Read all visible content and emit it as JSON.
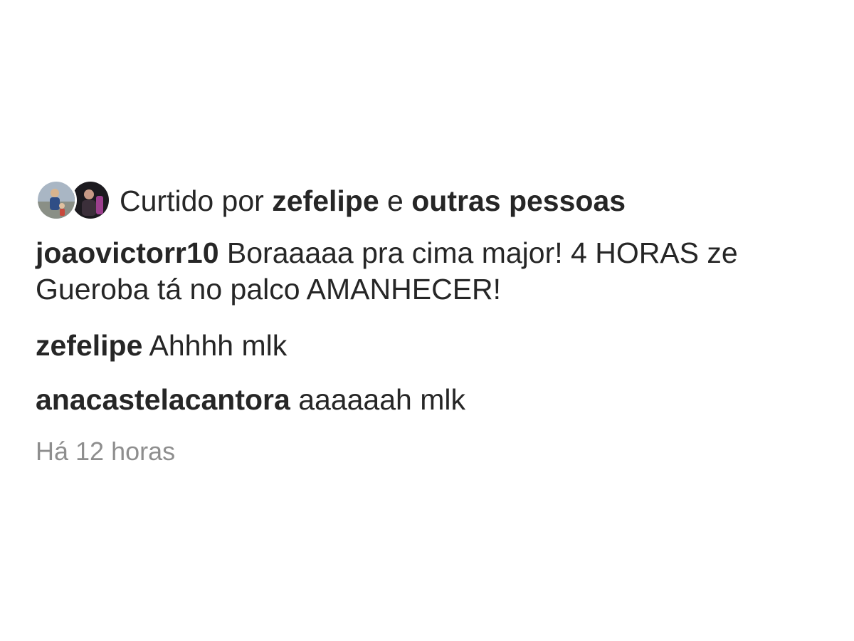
{
  "likes": {
    "prefix": "Curtido por",
    "user": "zefelipe",
    "connector": "e",
    "others": "outras pessoas",
    "avatars": [
      "avatar-icon",
      "avatar-icon"
    ]
  },
  "comments": [
    {
      "username": "joaovictorr10",
      "text_line1": "Boraaaaa pra cima major! 4 HORAS ze",
      "text_line2": "Gueroba tá no palco AMANHECER!"
    },
    {
      "username": "zefelipe",
      "text_line1": "Ahhhh mlk"
    },
    {
      "username": "anacastelacantora",
      "text_line1": "aaaaaah mlk"
    }
  ],
  "timestamp": "Há 12 horas",
  "colors": {
    "text": "#262626",
    "muted": "#8e8e8e",
    "background": "#ffffff"
  }
}
